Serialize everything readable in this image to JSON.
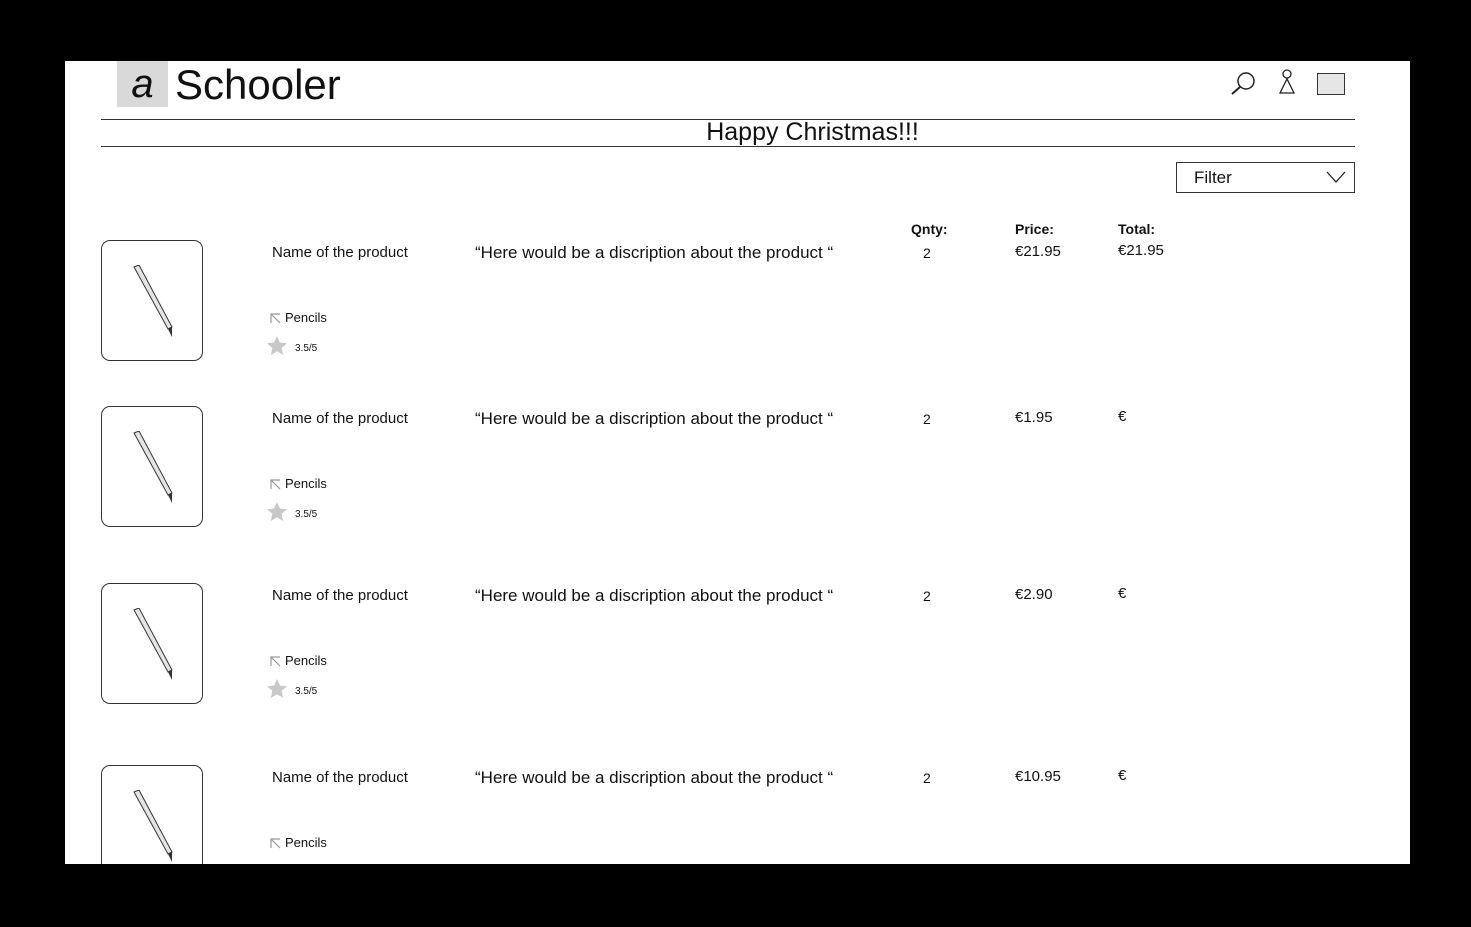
{
  "header": {
    "logo_letter": "a",
    "brand": "Schooler",
    "icons": [
      "search-icon",
      "user-icon",
      "cart-icon"
    ]
  },
  "banner": {
    "text": "Happy Christmas!!!"
  },
  "filter": {
    "label": "Filter"
  },
  "columns": {
    "qty": "Qnty:",
    "price": "Price:",
    "total": "Total:"
  },
  "products": [
    {
      "name": "Name of the product",
      "description": "“Here would be a discription about the product “",
      "qty": "2",
      "price": "€21.95",
      "total": "€21.95",
      "category": "Pencils",
      "rating": "3.5/5"
    },
    {
      "name": "Name of the product",
      "description": "“Here would be a discription about the product “",
      "qty": "2",
      "price": "€1.95",
      "total": "€",
      "category": "Pencils",
      "rating": "3.5/5"
    },
    {
      "name": "Name of the product",
      "description": "“Here would be a discription about the product “",
      "qty": "2",
      "price": "€2.90",
      "total": "€",
      "category": "Pencils",
      "rating": "3.5/5"
    },
    {
      "name": "Name of the product",
      "description": "“Here would be a discription about the product “",
      "qty": "2",
      "price": "€10.95",
      "total": "€",
      "category": "Pencils",
      "rating": ""
    }
  ],
  "colors": {
    "page_bg": "#000000",
    "canvas_bg": "#ffffff",
    "logo_bg": "#d9d9d9",
    "star": "#c8c8c8"
  }
}
